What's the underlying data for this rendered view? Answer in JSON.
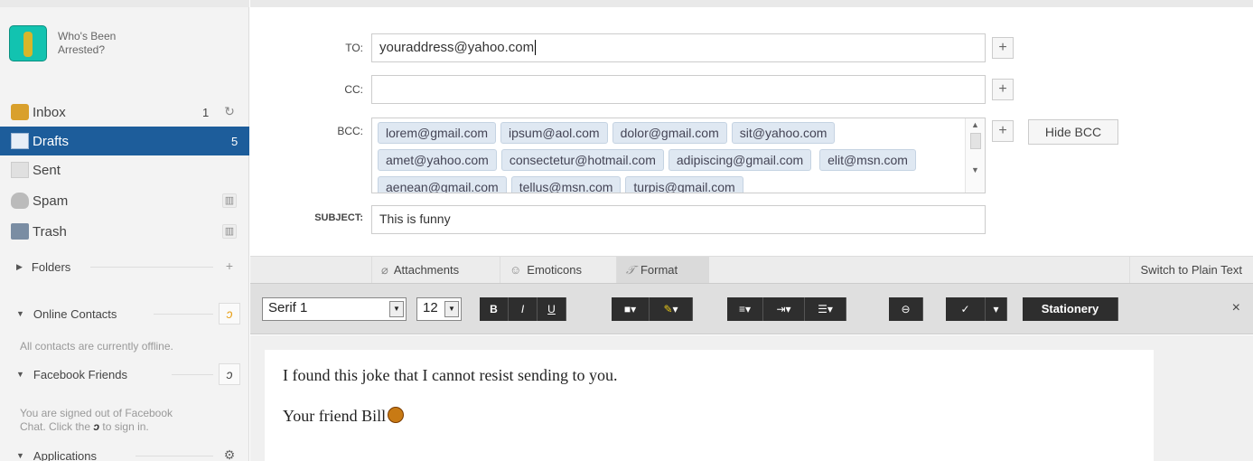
{
  "profile": {
    "name": "Who's Been Arrested?"
  },
  "folders": [
    {
      "label": "Inbox",
      "count": "1"
    },
    {
      "label": "Drafts",
      "count": "5"
    },
    {
      "label": "Sent",
      "count": ""
    },
    {
      "label": "Spam",
      "count": ""
    },
    {
      "label": "Trash",
      "count": ""
    }
  ],
  "sections": {
    "folders": "Folders",
    "online_contacts": "Online Contacts",
    "online_note": "All contacts are currently offline.",
    "facebook": "Facebook Friends",
    "facebook_note_1": "You are signed out of Facebook",
    "facebook_note_2": "Chat. Click the",
    "facebook_note_3": "to sign in.",
    "applications": "Applications"
  },
  "compose": {
    "to_label": "TO:",
    "to_value": "youraddress@yahoo.com",
    "cc_label": "CC:",
    "cc_value": "",
    "bcc_label": "BCC:",
    "bcc_recipients": [
      "lorem@gmail.com",
      "ipsum@aol.com",
      "dolor@gmail.com",
      "sit@yahoo.com",
      "amet@yahoo.com",
      "consectetur@hotmail.com",
      "adipiscing@gmail.com",
      "elit@msn.com",
      "aenean@gmail.com",
      "tellus@msn.com",
      "turpis@gmail.com"
    ],
    "hide_bcc": "Hide BCC",
    "subject_label": "SUBJECT:",
    "subject_value": "This is funny"
  },
  "tabs": {
    "attachments": "Attachments",
    "emoticons": "Emoticons",
    "format": "Format",
    "switch_plain": "Switch to Plain Text"
  },
  "toolbar": {
    "font": "Serif 1",
    "size": "12",
    "bold": "B",
    "italic": "I",
    "underline": "U",
    "stationery": "Stationery"
  },
  "body": {
    "line1": "I found this joke that I cannot resist sending to you.",
    "line2": "Your friend Bill"
  }
}
